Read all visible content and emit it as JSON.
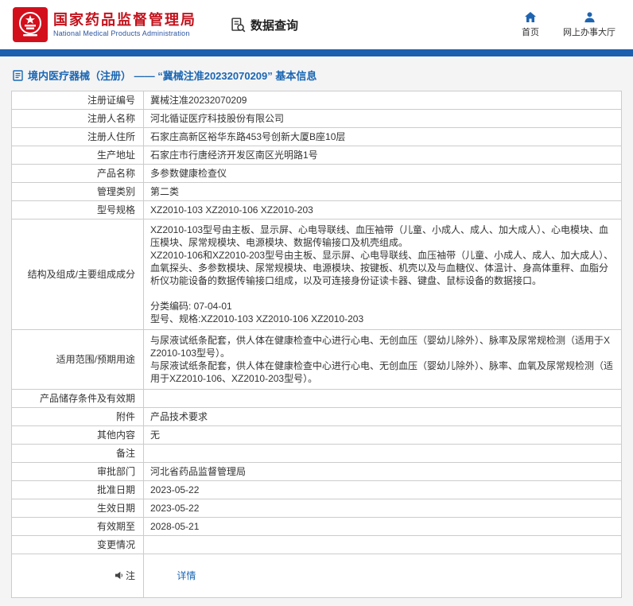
{
  "header": {
    "agency_cn": "国家药品监督管理局",
    "agency_en": "National Medical Products Administration",
    "data_query_label": "数据查询",
    "nav": {
      "home_label": "首页",
      "online_hall_label": "网上办事大厅"
    }
  },
  "breadcrumb": {
    "title": "境内医疗器械（注册） ——  “冀械注准20232070209” 基本信息"
  },
  "detail_table": {
    "rows": [
      {
        "label": "注册证编号",
        "value": "冀械注准20232070209"
      },
      {
        "label": "注册人名称",
        "value": "河北循证医疗科技股份有限公司"
      },
      {
        "label": "注册人住所",
        "value": "石家庄高新区裕华东路453号创新大厦B座10层"
      },
      {
        "label": "生产地址",
        "value": "石家庄市行唐经济开发区南区光明路1号"
      },
      {
        "label": "产品名称",
        "value": "多参数健康检查仪"
      },
      {
        "label": "管理类别",
        "value": "第二类"
      },
      {
        "label": "型号规格",
        "value": "XZ2010-103 XZ2010-106 XZ2010-203"
      },
      {
        "label": "结构及组成/主要组成成分",
        "value": "XZ2010-103型号由主板、显示屏、心电导联线、血压袖带（儿童、小成人、成人、加大成人）、心电模块、血压模块、尿常规模块、电源模块、数据传输接口及机壳组成。\nXZ2010-106和XZ2010-203型号由主板、显示屏、心电导联线、血压袖带（儿童、小成人、成人、加大成人）、血氧探头、多参数模块、尿常规模块、电源模块、按键板、机壳以及与血糖仪、体温计、身高体重秤、血脂分析仪功能设备的数据传输接口组成，以及可连接身份证读卡器、键盘、鼠标设备的数据接口。\n\n分类编码: 07-04-01\n型号、规格:XZ2010-103 XZ2010-106 XZ2010-203"
      },
      {
        "label": "适用范围/预期用途",
        "value": "与尿液试纸条配套，供人体在健康检查中心进行心电、无创血压（婴幼儿除外）、脉率及尿常规检测（适用于XZ2010-103型号）。\n与尿液试纸条配套，供人体在健康检查中心进行心电、无创血压（婴幼儿除外）、脉率、血氧及尿常规检测（适用于XZ2010-106、XZ2010-203型号）。"
      },
      {
        "label": "产品储存条件及有效期",
        "value": ""
      },
      {
        "label": "附件",
        "value": "产品技术要求"
      },
      {
        "label": "其他内容",
        "value": "无"
      },
      {
        "label": "备注",
        "value": ""
      },
      {
        "label": "审批部门",
        "value": "河北省药品监督管理局"
      },
      {
        "label": "批准日期",
        "value": "2023-05-22"
      },
      {
        "label": "生效日期",
        "value": "2023-05-22"
      },
      {
        "label": "有效期至",
        "value": "2028-05-21"
      },
      {
        "label": "变更情况",
        "value": ""
      }
    ],
    "note_row": {
      "label": "注",
      "link_label": "详情"
    }
  },
  "icons": {
    "logo": "national-emblem",
    "data_query": "document-search-icon",
    "home": "home-icon",
    "online_hall": "person-icon",
    "breadcrumb": "document-icon",
    "note": "megaphone-icon"
  },
  "colors": {
    "brand_red": "#c3121c",
    "accent_blue": "#1a66b3",
    "bar_blue": "#1c5fae",
    "link_blue": "#1a66b3",
    "border_gray": "#cccccc"
  }
}
